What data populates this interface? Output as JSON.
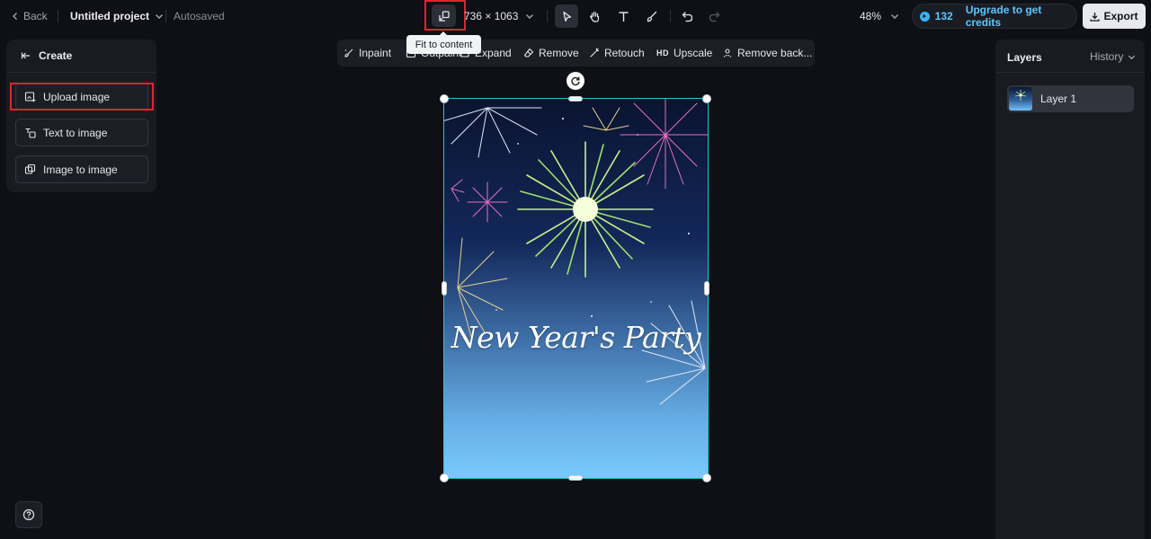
{
  "header": {
    "back_label": "Back",
    "project_title": "Untitled project",
    "autosave_status": "Autosaved",
    "dimensions": "736 × 1063",
    "fit_tooltip": "Fit to content",
    "zoom": "48%",
    "credits": "132",
    "upgrade_label": "Upgrade to get credits",
    "export_label": "Export",
    "tools": [
      "select-tool",
      "hand-tool",
      "text-tool",
      "brush-tool",
      "undo",
      "redo"
    ]
  },
  "left_panel": {
    "title": "Create",
    "buttons": [
      {
        "label": "Upload image",
        "icon": "upload-image-icon"
      },
      {
        "label": "Text to image",
        "icon": "text-to-image-icon"
      },
      {
        "label": "Image to image",
        "icon": "image-to-image-icon"
      }
    ]
  },
  "edit_toolbar": {
    "items": [
      {
        "label": "Inpaint",
        "icon": "inpaint-icon"
      },
      {
        "label": "Outpaint",
        "icon": "outpaint-icon"
      },
      {
        "label": "Expand",
        "icon": "expand-icon"
      },
      {
        "label": "Remove",
        "icon": "eraser-icon"
      },
      {
        "label": "Retouch",
        "icon": "retouch-icon"
      },
      {
        "label": "Upscale",
        "icon": "hd-icon",
        "badge": "HD"
      },
      {
        "label": "Remove back...",
        "icon": "remove-background-icon"
      }
    ]
  },
  "canvas": {
    "image_text": "New Year's Party"
  },
  "right_panel": {
    "title": "Layers",
    "history_label": "History",
    "layers": [
      {
        "name": "Layer 1"
      }
    ]
  },
  "colors": {
    "accent": "#5bc7ff",
    "highlight": "#e0242e",
    "selection": "#1ec9d6",
    "background": "#0f1015",
    "panel": "#1a1b21"
  }
}
